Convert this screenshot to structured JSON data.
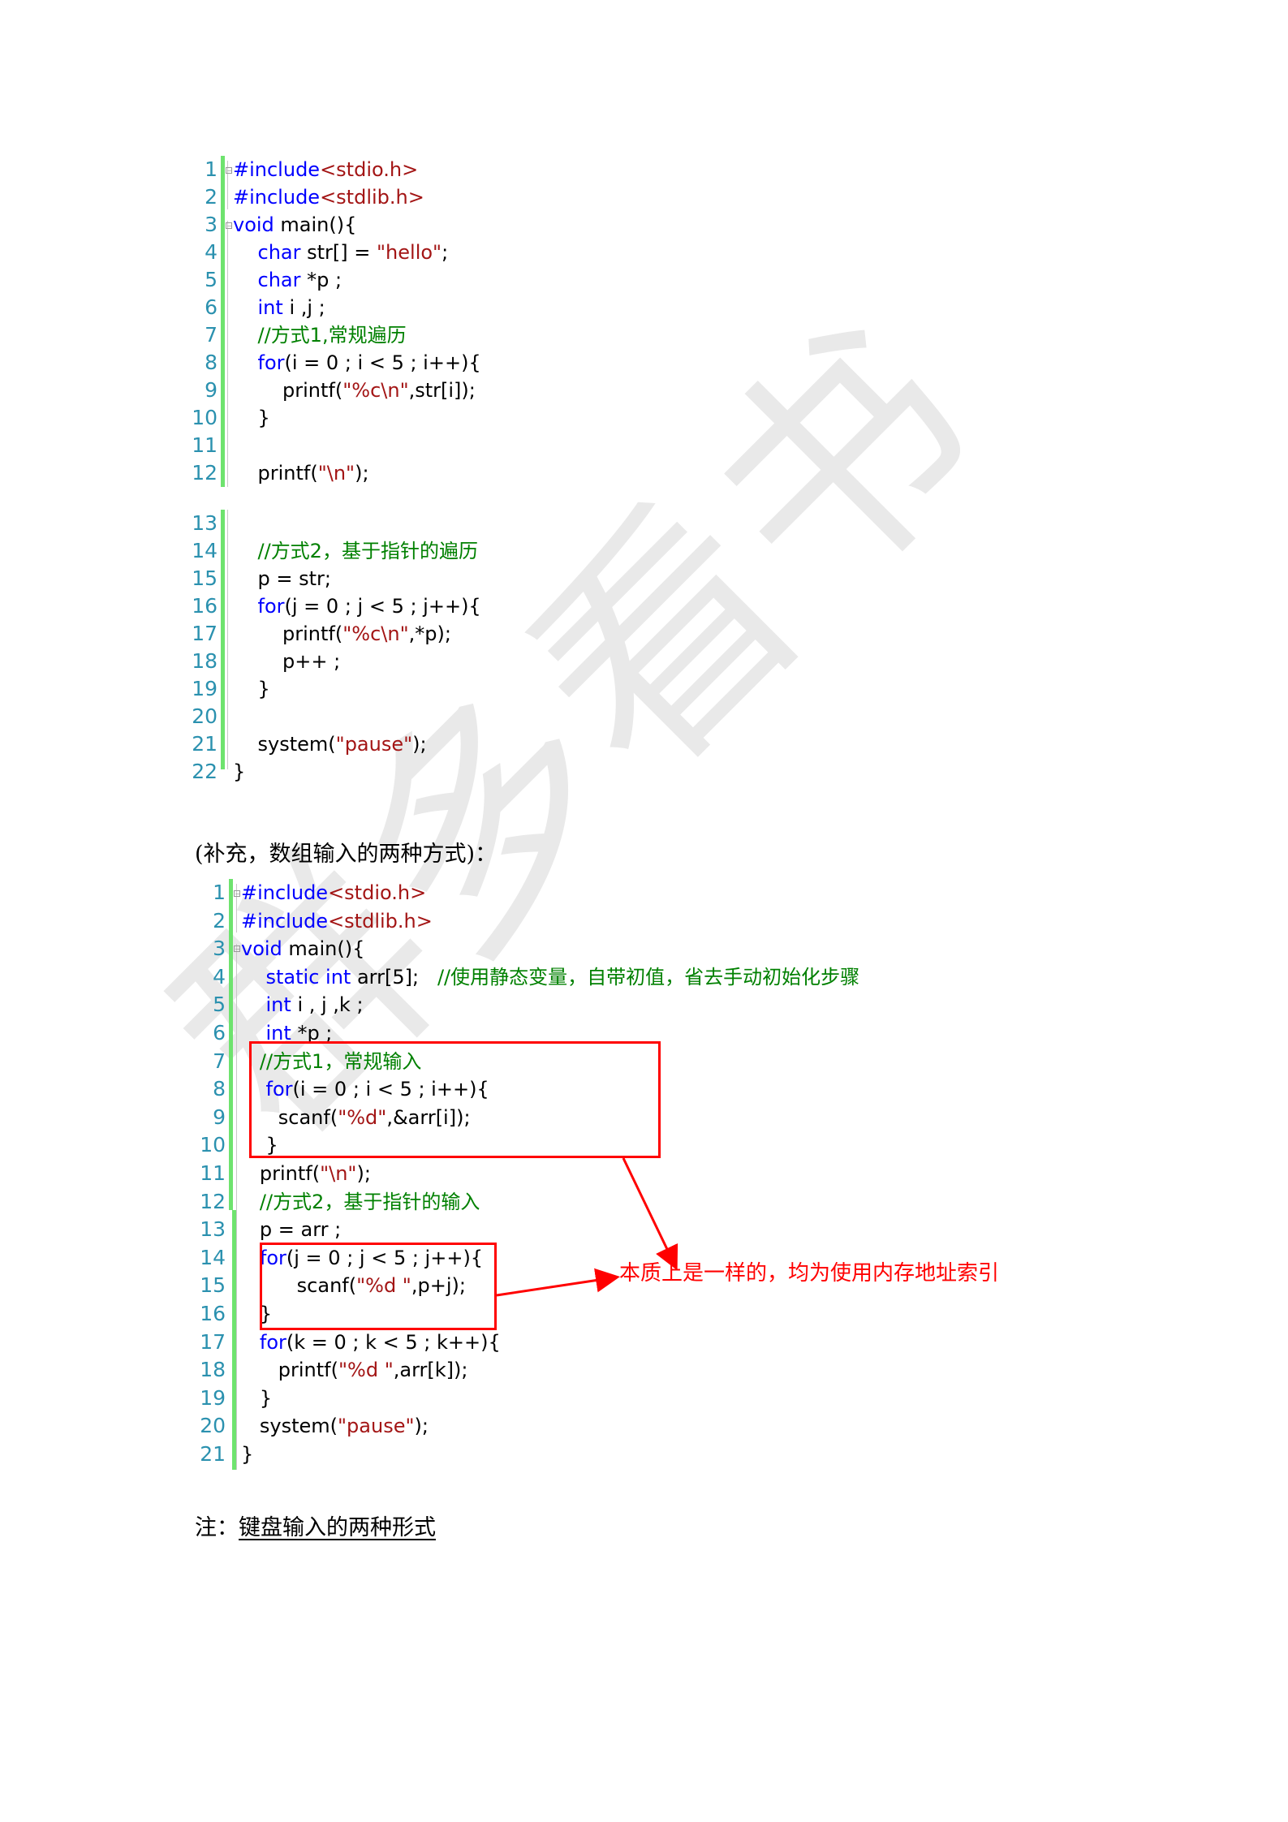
{
  "watermark": "群多看书",
  "colors": {
    "keyword": "#0000ff",
    "string": "#a31515",
    "comment": "#008000",
    "line_number": "#2b91af",
    "gutter_changed": "#6ee36e",
    "annotation": "#ff0000"
  },
  "block1": {
    "lines": [
      {
        "n": "1",
        "parts": [
          [
            "kw",
            "#include"
          ],
          [
            "str",
            "<stdio.h>"
          ]
        ]
      },
      {
        "n": "2",
        "parts": [
          [
            "kw",
            "#include"
          ],
          [
            "str",
            "<stdlib.h>"
          ]
        ]
      },
      {
        "n": "3",
        "parts": [
          [
            "kw",
            "void"
          ],
          [
            "",
            " main(){"
          ]
        ]
      },
      {
        "n": "4",
        "parts": [
          [
            "",
            "    "
          ],
          [
            "kw",
            "char"
          ],
          [
            "",
            " str[] = "
          ],
          [
            "str",
            "\"hello\""
          ],
          [
            "",
            ";"
          ]
        ]
      },
      {
        "n": "5",
        "parts": [
          [
            "",
            "    "
          ],
          [
            "kw",
            "char"
          ],
          [
            "",
            " *p ;"
          ]
        ]
      },
      {
        "n": "6",
        "parts": [
          [
            "",
            "    "
          ],
          [
            "kw",
            "int"
          ],
          [
            "",
            " i ,j ;"
          ]
        ]
      },
      {
        "n": "7",
        "parts": [
          [
            "",
            "    "
          ],
          [
            "cm",
            "//方式1,常规遍历"
          ]
        ]
      },
      {
        "n": "8",
        "parts": [
          [
            "",
            "    "
          ],
          [
            "kw",
            "for"
          ],
          [
            "",
            "(i = 0 ; i < 5 ; i++){"
          ]
        ]
      },
      {
        "n": "9",
        "parts": [
          [
            "",
            "        printf("
          ],
          [
            "str",
            "\"%c\\n\""
          ],
          [
            "",
            ",str[i]);"
          ]
        ]
      },
      {
        "n": "10",
        "parts": [
          [
            "",
            "    }"
          ]
        ]
      },
      {
        "n": "11",
        "parts": [
          [
            "",
            ""
          ]
        ]
      },
      {
        "n": "12",
        "parts": [
          [
            "",
            "    printf("
          ],
          [
            "str",
            "\"\\n\""
          ],
          [
            "",
            ");"
          ]
        ]
      },
      {
        "n": "13",
        "parts": [
          [
            "",
            ""
          ]
        ]
      },
      {
        "n": "14",
        "parts": [
          [
            "",
            "    "
          ],
          [
            "cm",
            "//方式2，基于指针的遍历"
          ]
        ]
      },
      {
        "n": "15",
        "parts": [
          [
            "",
            "    p = str;"
          ]
        ]
      },
      {
        "n": "16",
        "parts": [
          [
            "",
            "    "
          ],
          [
            "kw",
            "for"
          ],
          [
            "",
            "(j = 0 ; j < 5 ; j++){"
          ]
        ]
      },
      {
        "n": "17",
        "parts": [
          [
            "",
            "        printf("
          ],
          [
            "str",
            "\"%c\\n\""
          ],
          [
            "",
            ",*p);"
          ]
        ]
      },
      {
        "n": "18",
        "parts": [
          [
            "",
            "        p++ ;"
          ]
        ]
      },
      {
        "n": "19",
        "parts": [
          [
            "",
            "    }"
          ]
        ]
      },
      {
        "n": "20",
        "parts": [
          [
            "",
            ""
          ]
        ]
      },
      {
        "n": "21",
        "parts": [
          [
            "",
            "    system("
          ],
          [
            "str",
            "\"pause\""
          ],
          [
            "",
            ");"
          ]
        ]
      },
      {
        "n": "22",
        "parts": [
          [
            "",
            "}"
          ]
        ]
      }
    ]
  },
  "supplement_heading": "(补充，数组输入的两种方式)：",
  "block2": {
    "lines": [
      {
        "n": "1",
        "parts": [
          [
            "kw",
            "#include"
          ],
          [
            "str",
            "<stdio.h>"
          ]
        ]
      },
      {
        "n": "2",
        "parts": [
          [
            "kw",
            "#include"
          ],
          [
            "str",
            "<stdlib.h>"
          ]
        ]
      },
      {
        "n": "3",
        "parts": [
          [
            "kw",
            "void"
          ],
          [
            "",
            " main(){"
          ]
        ]
      },
      {
        "n": "4",
        "parts": [
          [
            "",
            "    "
          ],
          [
            "kw",
            "static int"
          ],
          [
            "",
            " arr[5];   "
          ],
          [
            "cm",
            "//使用静态变量，自带初值，省去手动初始化步骤"
          ]
        ]
      },
      {
        "n": "5",
        "parts": [
          [
            "",
            "    "
          ],
          [
            "kw",
            "int"
          ],
          [
            "",
            " i , j ,k ;"
          ]
        ]
      },
      {
        "n": "6",
        "parts": [
          [
            "",
            "    "
          ],
          [
            "kw",
            "int"
          ],
          [
            "",
            " *p ;"
          ]
        ]
      },
      {
        "n": "7",
        "parts": [
          [
            "",
            "   "
          ],
          [
            "cm",
            "//方式1，常规输入"
          ]
        ]
      },
      {
        "n": "8",
        "parts": [
          [
            "",
            "    "
          ],
          [
            "kw",
            "for"
          ],
          [
            "",
            "(i = 0 ; i < 5 ; i++){"
          ]
        ]
      },
      {
        "n": "9",
        "parts": [
          [
            "",
            "      scanf("
          ],
          [
            "str",
            "\"%d\""
          ],
          [
            "",
            ",&arr[i]);"
          ]
        ]
      },
      {
        "n": "10",
        "parts": [
          [
            "",
            "    }"
          ]
        ]
      },
      {
        "n": "11",
        "parts": [
          [
            "",
            "   printf("
          ],
          [
            "str",
            "\"\\n\""
          ],
          [
            "",
            ");"
          ]
        ]
      },
      {
        "n": "12",
        "parts": [
          [
            "",
            "   "
          ],
          [
            "cm",
            "//方式2，基于指针的输入"
          ]
        ]
      },
      {
        "n": "13",
        "parts": [
          [
            "",
            "   p = arr ;"
          ]
        ]
      },
      {
        "n": "14",
        "parts": [
          [
            "",
            "   "
          ],
          [
            "kw",
            "for"
          ],
          [
            "",
            "(j = 0 ; j < 5 ; j++){"
          ]
        ]
      },
      {
        "n": "15",
        "parts": [
          [
            "",
            "         scanf("
          ],
          [
            "str",
            "\"%d \""
          ],
          [
            "",
            ",p+j);"
          ]
        ]
      },
      {
        "n": "16",
        "parts": [
          [
            "",
            "   }"
          ]
        ]
      },
      {
        "n": "17",
        "parts": [
          [
            "",
            "   "
          ],
          [
            "kw",
            "for"
          ],
          [
            "",
            "(k = 0 ; k < 5 ; k++){"
          ]
        ]
      },
      {
        "n": "18",
        "parts": [
          [
            "",
            "      printf("
          ],
          [
            "str",
            "\"%d \""
          ],
          [
            "",
            ",arr[k]);"
          ]
        ]
      },
      {
        "n": "19",
        "parts": [
          [
            "",
            "   }"
          ]
        ]
      },
      {
        "n": "20",
        "parts": [
          [
            "",
            "   system("
          ],
          [
            "str",
            "\"pause\""
          ],
          [
            "",
            ");"
          ]
        ]
      },
      {
        "n": "21",
        "parts": [
          [
            "",
            "}"
          ]
        ]
      }
    ]
  },
  "annotation": "本质上是一样的，均为使用内存地址索引",
  "note": {
    "prefix": "注：",
    "title": "键盘输入的两种形式"
  }
}
